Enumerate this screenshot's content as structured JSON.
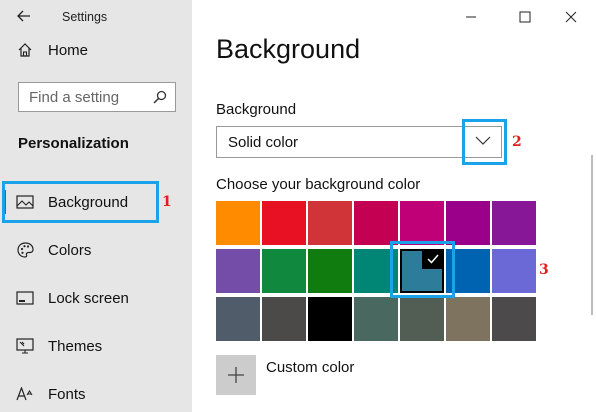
{
  "window": {
    "title": "Settings"
  },
  "sidebar": {
    "home_label": "Home",
    "search_placeholder": "Find a setting",
    "section_heading": "Personalization",
    "items": [
      {
        "label": "Background",
        "icon": "picture-icon",
        "selected": true
      },
      {
        "label": "Colors",
        "icon": "palette-icon",
        "selected": false
      },
      {
        "label": "Lock screen",
        "icon": "lock-screen-icon",
        "selected": false
      },
      {
        "label": "Themes",
        "icon": "themes-icon",
        "selected": false
      },
      {
        "label": "Fonts",
        "icon": "fonts-icon",
        "selected": false
      }
    ]
  },
  "main": {
    "title": "Background",
    "background_label": "Background",
    "background_value": "Solid color",
    "color_label": "Choose your background color",
    "custom_color_label": "Custom color",
    "swatch_rows": [
      [
        "#ff8c00",
        "#e81123",
        "#d13438",
        "#c30052",
        "#bf0077",
        "#9a0089",
        "#881798"
      ],
      [
        "#744da9",
        "#10893e",
        "#107c10",
        "#018574",
        "#2d7d9a",
        "#0063b1",
        "#6b69d6"
      ],
      [
        "#515c6b",
        "#4c4a48",
        "#000000",
        "#486860",
        "#525e54",
        "#7e735f",
        "#4c4a4b"
      ]
    ],
    "selected_swatch": {
      "row": 1,
      "col": 4
    }
  },
  "annotations": [
    "1",
    "2",
    "3"
  ],
  "colors": {
    "callout_border": "#1aa3e8",
    "callout_number": "#e02020",
    "accent": "#0a74c4"
  }
}
